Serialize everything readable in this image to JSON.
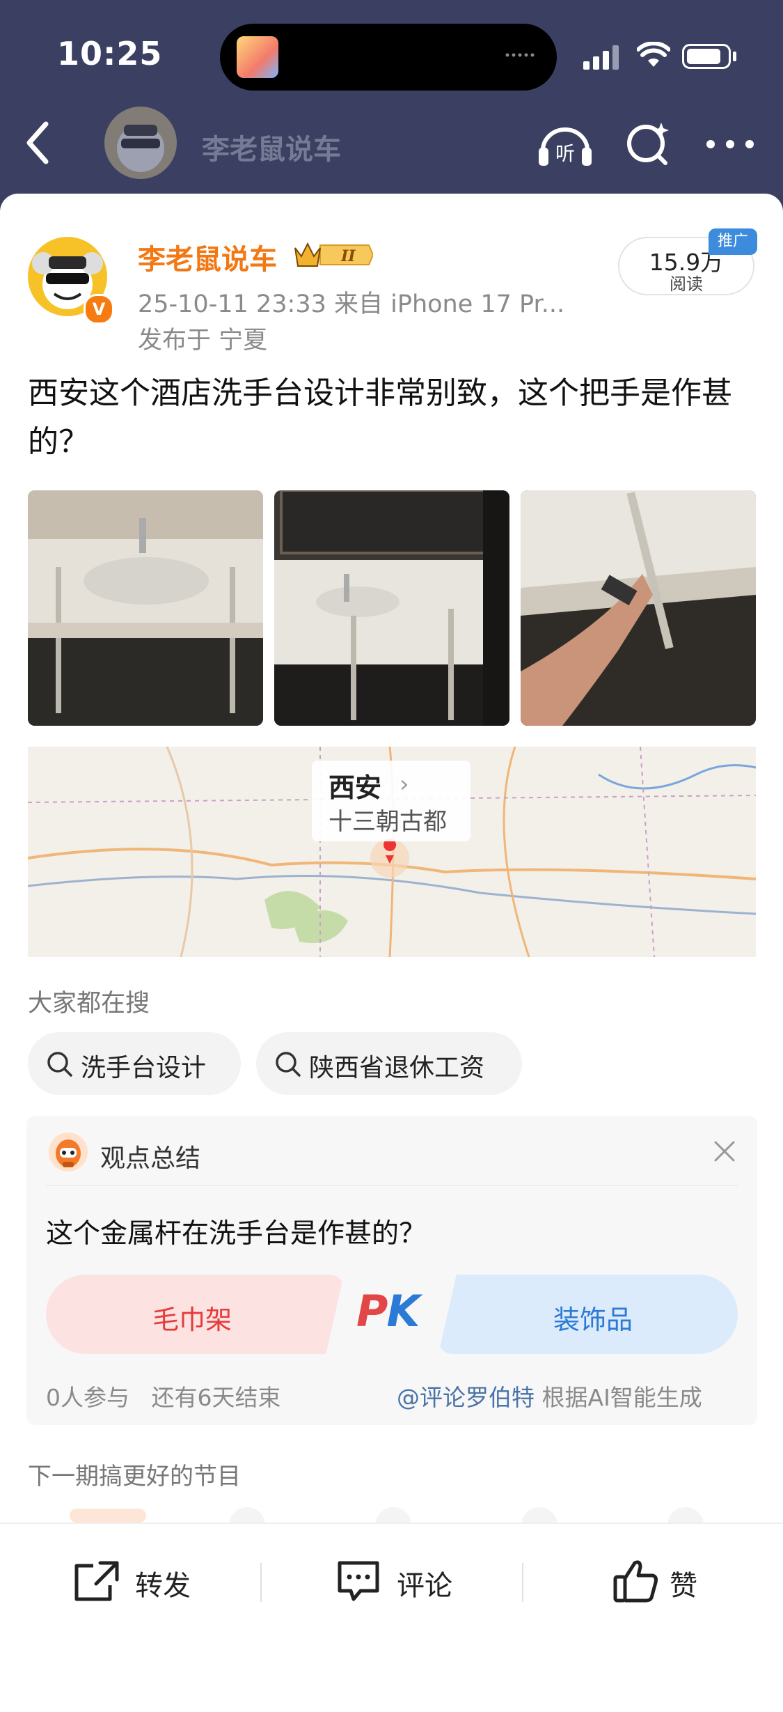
{
  "status_bar": {
    "time": "10:25"
  },
  "header": {
    "account_name": "李老鼠说车",
    "listen_label": "听"
  },
  "post": {
    "author": "李老鼠说车",
    "level_badge": "II",
    "timestamp_source": "25-10-11 23:33  来自 iPhone 17 Pr...",
    "location": "发布于 宁夏",
    "reads_count": "15.9万",
    "reads_label": "阅读",
    "promo_tag": "推广",
    "text": "西安这个酒店洗手台设计非常别致，这个把手是作甚的？"
  },
  "map_card": {
    "title": "西安",
    "subtitle": "十三朝古都"
  },
  "searches": {
    "heading": "大家都在搜",
    "chips": [
      "洗手台设计",
      "陕西省退休工资"
    ]
  },
  "summary": {
    "title": "观点总结",
    "question": "这个金属杆在洗手台是作甚的？",
    "option_left": "毛巾架",
    "option_right": "装饰品",
    "pk_p": "P",
    "pk_k": "K",
    "participants": "0人参与",
    "remaining": "还有6天结束",
    "mention": "@评论罗伯特",
    "source": "根据AI智能生成"
  },
  "next_section": {
    "label": "下一期搞更好的节目"
  },
  "action_bar": {
    "share": "转发",
    "comment": "评论",
    "like": "赞"
  },
  "colors": {
    "accent_orange": "#f27814",
    "brand_blue": "#2b7ad6",
    "pk_red": "#e24646"
  }
}
